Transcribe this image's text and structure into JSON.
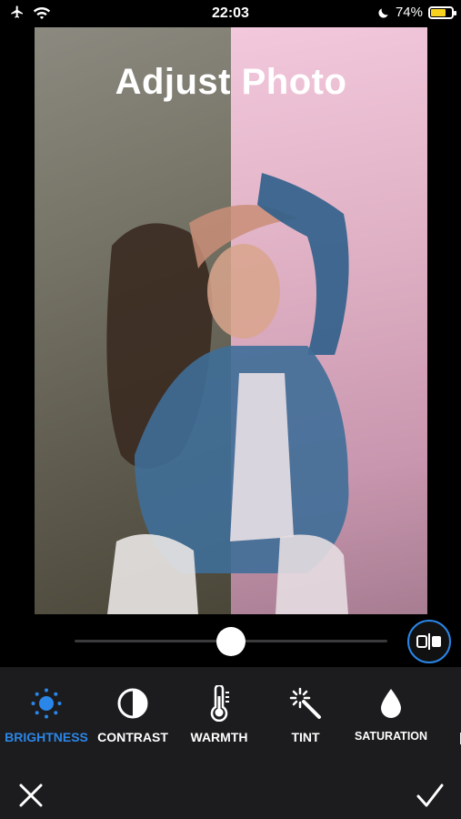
{
  "status_bar": {
    "time": "22:03",
    "battery_percent": "74%",
    "battery_level": 0.74,
    "battery_color": "#f7d21e",
    "left_icons": [
      "airplane-icon",
      "wifi-icon"
    ],
    "right_icons": [
      "moon-icon",
      "battery-icon"
    ]
  },
  "photo": {
    "title": "Adjust Photo"
  },
  "slider": {
    "value": 0.5
  },
  "tools": [
    {
      "label": "BRIGHTNESS",
      "icon": "sun-icon",
      "active": true
    },
    {
      "label": "CONTRAST",
      "icon": "contrast-icon",
      "active": false
    },
    {
      "label": "WARMTH",
      "icon": "thermometer-icon",
      "active": false
    },
    {
      "label": "TINT",
      "icon": "magic-wand-icon",
      "active": false
    },
    {
      "label": "SATURATION",
      "icon": "drop-icon",
      "active": false
    }
  ],
  "colors": {
    "accent": "#2a86e8",
    "toolbar_bg": "#1c1c1e"
  }
}
